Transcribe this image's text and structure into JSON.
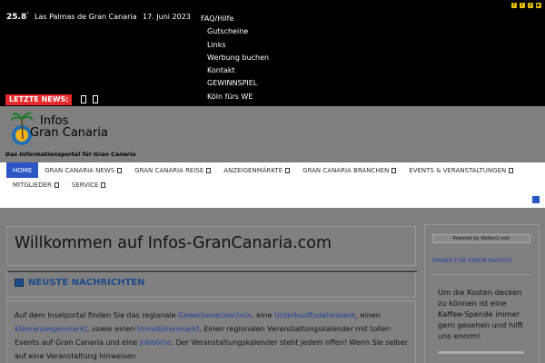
{
  "topbar": {
    "temperature": "25.8",
    "temp_unit": "°",
    "city": "Las Palmas de Gran Canaria",
    "date": "17. Juni 2023",
    "menu": [
      "FAQ/Hilfe",
      "Gutscheine",
      "Links",
      "Werbung buchen",
      "Kontakt",
      "GEWINNSPIEL",
      "Köln fürs WE"
    ],
    "social_icons": [
      "facebook-icon",
      "twitter-icon",
      "instagram-icon",
      "youtube-icon"
    ],
    "ticker_label": "LETZTE NEWS:"
  },
  "header": {
    "logo_line1": "Infos",
    "logo_line2": "Gran Canaria",
    "tagline": "Das Informationsportal für Gran Canaria"
  },
  "nav": {
    "row1": [
      "HOME",
      "GRAN CANARIA NEWS",
      "GRAN CANARIA REISE",
      "ANZEIGENMÄRKTE",
      "GRAN CANARIA BRANCHEN",
      "EVENTS & VERANSTALTUNGEN"
    ],
    "row2": [
      "MITGLIEDER",
      "SERVICE"
    ]
  },
  "main": {
    "welcome": "Willkommen auf Infos-GranCanaria.com",
    "news_title": "NEUSTE NACHRICHTEN",
    "text_parts": {
      "p1": "Auf dem Inselportal finden Sie das regionale ",
      "l1": "Gewerbeverzeichnis",
      "p2": ", eine ",
      "l2": "Unterkunftsdatenbank",
      "p3": ", einen ",
      "l3": "Kleinanzeigenmarkt",
      "p4": ", sowie einen ",
      "l4": "Immobilienmarkt",
      "p5": ". Einen regionalen Veranstaltungskalender mit tollen Events auf Gran Canaria und eine ",
      "l5": "Jobbörse",
      "p6": ". Der Veranstaltungskalender steht jedem offen! Wenn Sie selber auf eine Veranstaltung hinweisen"
    }
  },
  "sidebar": {
    "wetter": "Powered by Wetter2.com",
    "kaffee_link": "DANKE FÜR EINEN KAFFEE!",
    "kaffee_text": "Um die Kosten decken zu können ist eine Kaffee-Spende immer gern gesehen und hilft uns enorm!"
  }
}
